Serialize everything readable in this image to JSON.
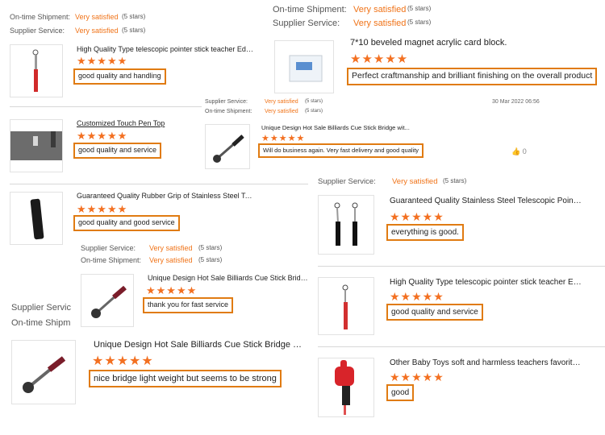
{
  "colors": {
    "accent": "#f07318",
    "star": "#f37021",
    "highlight_border": "#e07b12"
  },
  "labels": {
    "ontime": "On-time Shipment:",
    "supplier": "Supplier Service:",
    "supplier_cut": "Supplier Servic",
    "ontime_cut": "On-time Shipm",
    "very_satisfied": "Very satisfied",
    "five_stars": "(5 stars)",
    "stars_glyphs": "★★★★★"
  },
  "panel_tl": {
    "row1_key": "On-time Shipment:",
    "row2_key": "Supplier Service:",
    "product_title": "High Quality Type telescopic pointer stick teacher Edu...",
    "review": "good quality and handling"
  },
  "panel_tr": {
    "row1_key": "On-time Shipment:",
    "row2_key": "Supplier Service:",
    "product_title": "7*10 beveled magnet acrylic card block.",
    "review": "Perfect craftmanship and brilliant finishing on the overall product"
  },
  "panel_pen": {
    "product_title": "Customized Touch Pen Top",
    "review": "good quality and service"
  },
  "panel_cuestick_small": {
    "row1_key": "Supplier Service:",
    "row2_key": "On-time Shipment:",
    "date": "30 Mar 2022 06:56",
    "product_title": "Unique Design Hot Sale Billiards Cue Stick Bridge wit...",
    "review": "Will do business again. Very fast delivery and good quality",
    "likes": "0"
  },
  "panel_grip": {
    "product_title": "Guaranteed Quality Rubber Grip of Stainless Steel Tel...",
    "review": "good quality and good service"
  },
  "panel_guaranteed_pointer": {
    "row_key": "Supplier Service:",
    "product_title": "Guaranteed Quality Stainless Steel Telescopic Pointer...",
    "review": "everything is good."
  },
  "panel_cuestick_mid": {
    "row1_key": "Supplier Service:",
    "row2_key": "On-time Shipment:",
    "product_title": "Unique Design Hot Sale Billiards Cue Stick Bridge wit...",
    "review": "thank you for fast service"
  },
  "panel_high_quality_r": {
    "product_title": "High Quality Type telescopic pointer stick teacher Edu...",
    "review": "good quality and service"
  },
  "panel_cuestick_big": {
    "product_title": "Unique Design Hot Sale Billiards Cue Stick Bridge wit...",
    "review": "nice bridge light weight but seems to be strong"
  },
  "panel_baby": {
    "product_title": "Other Baby Toys soft and harmless teachers favorite t...",
    "review": "good"
  }
}
